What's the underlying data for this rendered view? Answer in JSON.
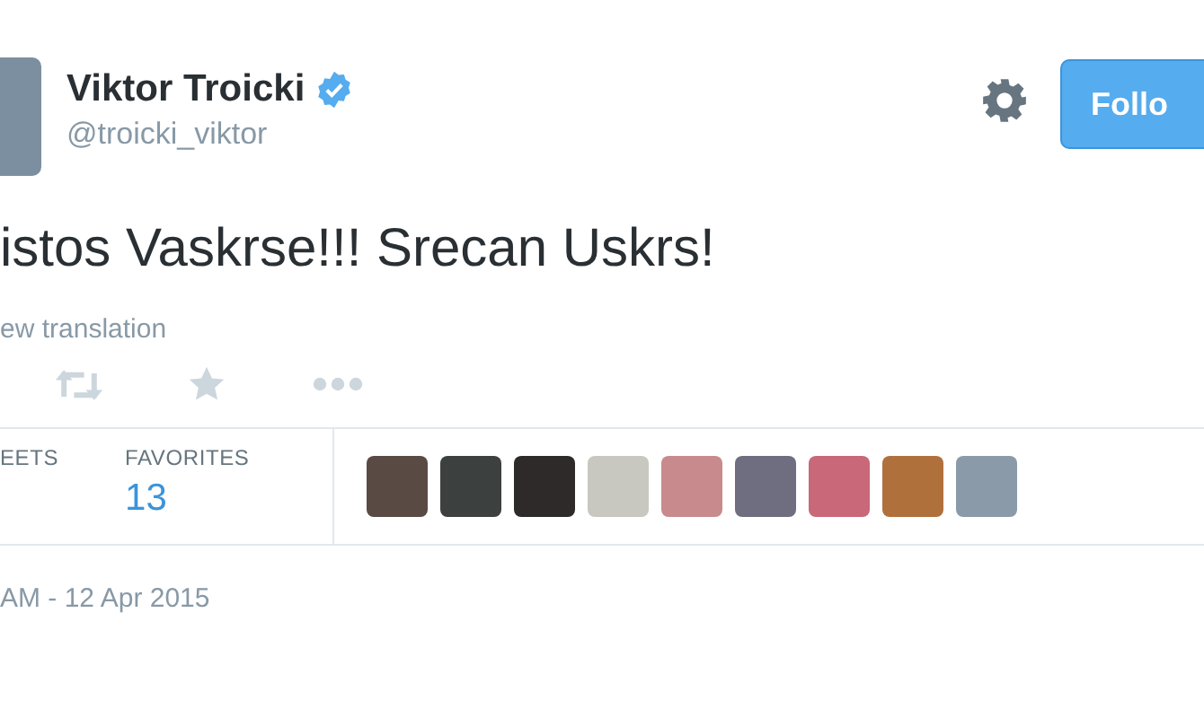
{
  "profile": {
    "name": "Viktor Troicki",
    "verified": true,
    "handle": "@troicki_viktor"
  },
  "follow_button": {
    "label": "Follo"
  },
  "tweet": {
    "text": "istos Vaskrse!!! Srecan Uskrs!",
    "translation_link": "ew translation"
  },
  "stats": [
    {
      "label": "EETS"
    },
    {
      "label": "FAVORITES",
      "value": "13"
    }
  ],
  "favoriters": [
    {
      "color": "#5a4a44"
    },
    {
      "color": "#3c403e"
    },
    {
      "color": "#2e2a2a"
    },
    {
      "color": "#c8c8c0"
    },
    {
      "color": "#c88a8c"
    },
    {
      "color": "#6e6e80"
    },
    {
      "color": "#c86878"
    },
    {
      "color": "#b0703c"
    },
    {
      "color": "#8a9aa8"
    }
  ],
  "timestamp": "AM - 12 Apr 2015"
}
